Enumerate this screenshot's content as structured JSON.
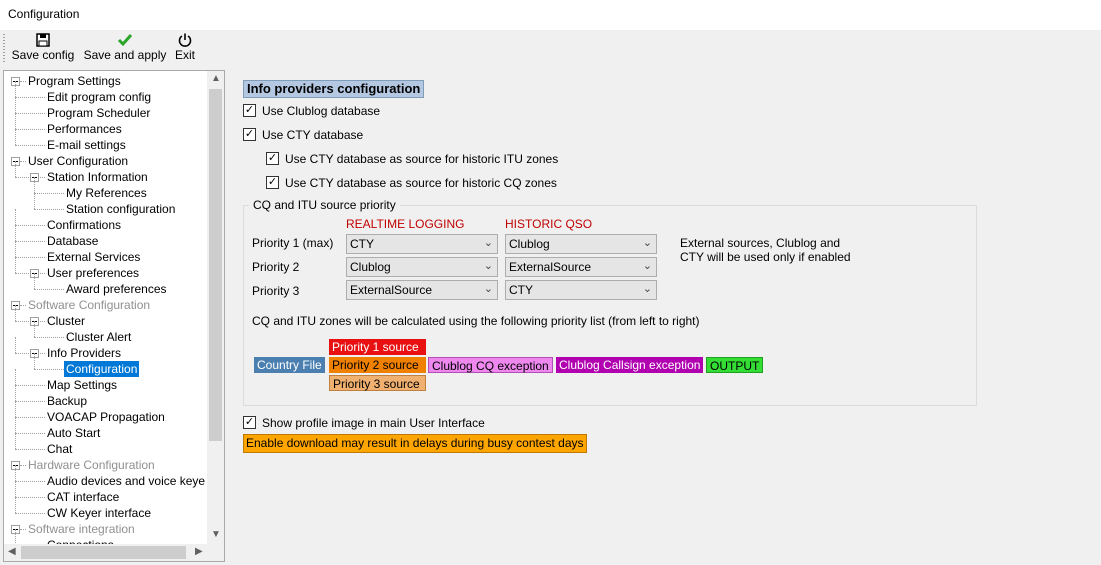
{
  "window": {
    "title": "Configuration"
  },
  "toolbar": {
    "save_config": "Save config",
    "save_apply": "Save and apply",
    "exit": "Exit"
  },
  "tree": {
    "items": [
      {
        "label": "Program Settings",
        "level": 0,
        "gray": false
      },
      {
        "label": "Edit program config",
        "level": 1
      },
      {
        "label": "Program Scheduler",
        "level": 1
      },
      {
        "label": "Performances",
        "level": 1
      },
      {
        "label": "E-mail settings",
        "level": 1
      },
      {
        "label": "User Configuration",
        "level": 0,
        "gray": false
      },
      {
        "label": "Station Information",
        "level": 1
      },
      {
        "label": "My References",
        "level": 2
      },
      {
        "label": "Station configuration",
        "level": 2
      },
      {
        "label": "Confirmations",
        "level": 1
      },
      {
        "label": "Database",
        "level": 1
      },
      {
        "label": "External Services",
        "level": 1
      },
      {
        "label": "User preferences",
        "level": 1
      },
      {
        "label": "Award preferences",
        "level": 2
      },
      {
        "label": "Software Configuration",
        "level": 0,
        "gray": true
      },
      {
        "label": "Cluster",
        "level": 1
      },
      {
        "label": "Cluster Alert",
        "level": 2
      },
      {
        "label": "Info Providers",
        "level": 1
      },
      {
        "label": "Configuration",
        "level": 2,
        "selected": true
      },
      {
        "label": "Map Settings",
        "level": 1
      },
      {
        "label": "Backup",
        "level": 1
      },
      {
        "label": "VOACAP Propagation",
        "level": 1
      },
      {
        "label": "Auto Start",
        "level": 1
      },
      {
        "label": "Chat",
        "level": 1
      },
      {
        "label": "Hardware Configuration",
        "level": 0,
        "gray": true
      },
      {
        "label": "Audio devices and voice keye",
        "level": 1
      },
      {
        "label": "CAT interface",
        "level": 1
      },
      {
        "label": "CW Keyer interface",
        "level": 1
      },
      {
        "label": "Software integration",
        "level": 0,
        "gray": true
      },
      {
        "label": "Connections",
        "level": 1
      }
    ]
  },
  "panel": {
    "title": "Info providers configuration",
    "use_clublog": "Use Clublog database",
    "use_cty": "Use CTY database",
    "cty_itu": "Use CTY database as source for historic ITU zones",
    "cty_cq": "Use CTY database as source for historic CQ zones",
    "group_title": "CQ and ITU source priority",
    "col_realtime": "REALTIME LOGGING",
    "col_historic": "HISTORIC QSO",
    "rows": [
      {
        "label": "Priority 1 (max)",
        "realtime": "CTY",
        "historic": "Clublog"
      },
      {
        "label": "Priority 2",
        "realtime": "Clublog",
        "historic": "ExternalSource"
      },
      {
        "label": "Priority 3",
        "realtime": "ExternalSource",
        "historic": "CTY"
      }
    ],
    "note_line1": "External sources, Clublog and",
    "note_line2": "CTY will be used only if enabled",
    "priority_text": "CQ and ITU zones will be calculated using the following priority list (from left to right)",
    "chips": {
      "country_file": "Country File",
      "p1": "Priority 1 source",
      "p2": "Priority 2 source",
      "p3": "Priority 3 source",
      "clublog_cq": "Clublog CQ exception",
      "clublog_call": "Clublog Callsign exception",
      "output": "OUTPUT"
    },
    "show_profile": "Show profile image in main User Interface",
    "warning": "Enable download may result in delays during busy contest days"
  },
  "checks": {
    "clublog": true,
    "cty": true,
    "cty_itu": true,
    "cty_cq": true,
    "profile": true
  },
  "colors": {
    "selected": "#0078d7",
    "p1": "#e81010",
    "p2": "#f08000",
    "p3": "#f0b070",
    "country_file": "#4a7fb0",
    "clublog_cq": "#ee88ee",
    "clublog_call": "#b000b0",
    "output": "#33dd33",
    "warning": "#ffa500"
  }
}
